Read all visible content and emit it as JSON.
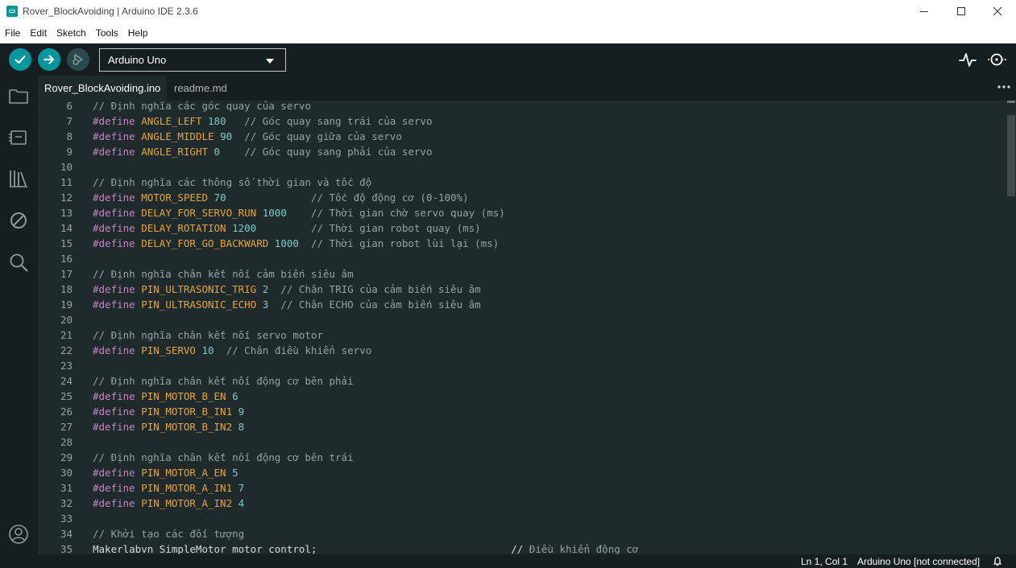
{
  "window": {
    "title": "Rover_BlockAvoiding | Arduino IDE 2.3.6"
  },
  "menu": [
    "File",
    "Edit",
    "Sketch",
    "Tools",
    "Help"
  ],
  "toolbar": {
    "verify_icon": "check-icon",
    "upload_icon": "arrow-right-icon",
    "debug_icon": "debug-icon",
    "board_selected": "Arduino Uno",
    "plotter_icon": "serial-plotter-icon",
    "monitor_icon": "serial-monitor-icon"
  },
  "sidebar": {
    "items": [
      "folder-icon",
      "board-manager-icon",
      "library-icon",
      "debug-disabled-icon",
      "search-icon"
    ],
    "bottom": "profile-icon"
  },
  "tabs": [
    {
      "label": "Rover_BlockAvoiding.ino",
      "active": true
    },
    {
      "label": "readme.md",
      "active": false
    }
  ],
  "editor": {
    "lines": [
      {
        "n": "6",
        "tokens": [
          [
            "cm",
            "// Định nghĩa các góc quay của servo"
          ]
        ]
      },
      {
        "n": "7",
        "tokens": [
          [
            "kw",
            "#define"
          ],
          [
            "plain",
            " "
          ],
          [
            "mac",
            "ANGLE_LEFT"
          ],
          [
            "plain",
            " "
          ],
          [
            "num",
            "180"
          ],
          [
            "plain",
            "   "
          ],
          [
            "cm",
            "// Góc quay sang trái của servo"
          ]
        ]
      },
      {
        "n": "8",
        "tokens": [
          [
            "kw",
            "#define"
          ],
          [
            "plain",
            " "
          ],
          [
            "mac",
            "ANGLE_MIDDLE"
          ],
          [
            "plain",
            " "
          ],
          [
            "num",
            "90"
          ],
          [
            "plain",
            "  "
          ],
          [
            "cm",
            "// Góc quay giữa của servo"
          ]
        ]
      },
      {
        "n": "9",
        "tokens": [
          [
            "kw",
            "#define"
          ],
          [
            "plain",
            " "
          ],
          [
            "mac",
            "ANGLE_RIGHT"
          ],
          [
            "plain",
            " "
          ],
          [
            "num",
            "0"
          ],
          [
            "plain",
            "    "
          ],
          [
            "cm",
            "// Góc quay sang phải của servo"
          ]
        ]
      },
      {
        "n": "10",
        "tokens": []
      },
      {
        "n": "11",
        "tokens": [
          [
            "cm",
            "// Định nghĩa các thông số thời gian và tốc độ"
          ]
        ]
      },
      {
        "n": "12",
        "tokens": [
          [
            "kw",
            "#define"
          ],
          [
            "plain",
            " "
          ],
          [
            "mac",
            "MOTOR_SPEED"
          ],
          [
            "plain",
            " "
          ],
          [
            "num",
            "70"
          ],
          [
            "plain",
            "              "
          ],
          [
            "cm",
            "// Tốc độ động cơ (0-100%)"
          ]
        ]
      },
      {
        "n": "13",
        "tokens": [
          [
            "kw",
            "#define"
          ],
          [
            "plain",
            " "
          ],
          [
            "mac",
            "DELAY_FOR_SERVO_RUN"
          ],
          [
            "plain",
            " "
          ],
          [
            "num",
            "1000"
          ],
          [
            "plain",
            "    "
          ],
          [
            "cm",
            "// Thời gian chờ servo quay (ms)"
          ]
        ]
      },
      {
        "n": "14",
        "tokens": [
          [
            "kw",
            "#define"
          ],
          [
            "plain",
            " "
          ],
          [
            "mac",
            "DELAY_ROTATION"
          ],
          [
            "plain",
            " "
          ],
          [
            "num",
            "1200"
          ],
          [
            "plain",
            "         "
          ],
          [
            "cm",
            "// Thời gian robot quay (ms)"
          ]
        ]
      },
      {
        "n": "15",
        "tokens": [
          [
            "kw",
            "#define"
          ],
          [
            "plain",
            " "
          ],
          [
            "mac",
            "DELAY_FOR_GO_BACKWARD"
          ],
          [
            "plain",
            " "
          ],
          [
            "num",
            "1000"
          ],
          [
            "plain",
            "  "
          ],
          [
            "cm",
            "// Thời gian robot lùi lại (ms)"
          ]
        ]
      },
      {
        "n": "16",
        "tokens": []
      },
      {
        "n": "17",
        "tokens": [
          [
            "cm",
            "// Định nghĩa chân kết nối cảm biến siêu âm"
          ]
        ]
      },
      {
        "n": "18",
        "tokens": [
          [
            "kw",
            "#define"
          ],
          [
            "plain",
            " "
          ],
          [
            "mac",
            "PIN_ULTRASONIC_TRIG"
          ],
          [
            "plain",
            " "
          ],
          [
            "num",
            "2"
          ],
          [
            "plain",
            "  "
          ],
          [
            "cm",
            "// Chân TRIG của cảm biến siêu âm"
          ]
        ]
      },
      {
        "n": "19",
        "tokens": [
          [
            "kw",
            "#define"
          ],
          [
            "plain",
            " "
          ],
          [
            "mac",
            "PIN_ULTRASONIC_ECHO"
          ],
          [
            "plain",
            " "
          ],
          [
            "num",
            "3"
          ],
          [
            "plain",
            "  "
          ],
          [
            "cm",
            "// Chân ECHO của cảm biến siêu âm"
          ]
        ]
      },
      {
        "n": "20",
        "tokens": []
      },
      {
        "n": "21",
        "tokens": [
          [
            "cm",
            "// Định nghĩa chân kết nối servo motor"
          ]
        ]
      },
      {
        "n": "22",
        "tokens": [
          [
            "kw",
            "#define"
          ],
          [
            "plain",
            " "
          ],
          [
            "mac",
            "PIN_SERVO"
          ],
          [
            "plain",
            " "
          ],
          [
            "num",
            "10"
          ],
          [
            "plain",
            "  "
          ],
          [
            "cm",
            "// Chân điều khiển servo"
          ]
        ]
      },
      {
        "n": "23",
        "tokens": []
      },
      {
        "n": "24",
        "tokens": [
          [
            "cm",
            "// Định nghĩa chân kết nối động cơ bên phải"
          ]
        ]
      },
      {
        "n": "25",
        "tokens": [
          [
            "kw",
            "#define"
          ],
          [
            "plain",
            " "
          ],
          [
            "mac",
            "PIN_MOTOR_B_EN"
          ],
          [
            "plain",
            " "
          ],
          [
            "num",
            "6"
          ]
        ]
      },
      {
        "n": "26",
        "tokens": [
          [
            "kw",
            "#define"
          ],
          [
            "plain",
            " "
          ],
          [
            "mac",
            "PIN_MOTOR_B_IN1"
          ],
          [
            "plain",
            " "
          ],
          [
            "num",
            "9"
          ]
        ]
      },
      {
        "n": "27",
        "tokens": [
          [
            "kw",
            "#define"
          ],
          [
            "plain",
            " "
          ],
          [
            "mac",
            "PIN_MOTOR_B_IN2"
          ],
          [
            "plain",
            " "
          ],
          [
            "num",
            "8"
          ]
        ]
      },
      {
        "n": "28",
        "tokens": []
      },
      {
        "n": "29",
        "tokens": [
          [
            "cm",
            "// Định nghĩa chân kết nối động cơ bên trái"
          ]
        ]
      },
      {
        "n": "30",
        "tokens": [
          [
            "kw",
            "#define"
          ],
          [
            "plain",
            " "
          ],
          [
            "mac",
            "PIN_MOTOR_A_EN"
          ],
          [
            "plain",
            " "
          ],
          [
            "num",
            "5"
          ]
        ]
      },
      {
        "n": "31",
        "tokens": [
          [
            "kw",
            "#define"
          ],
          [
            "plain",
            " "
          ],
          [
            "mac",
            "PIN_MOTOR_A_IN1"
          ],
          [
            "plain",
            " "
          ],
          [
            "num",
            "7"
          ]
        ]
      },
      {
        "n": "32",
        "tokens": [
          [
            "kw",
            "#define"
          ],
          [
            "plain",
            " "
          ],
          [
            "mac",
            "PIN_MOTOR_A_IN2"
          ],
          [
            "plain",
            " "
          ],
          [
            "num",
            "4"
          ]
        ]
      },
      {
        "n": "33",
        "tokens": []
      },
      {
        "n": "34",
        "tokens": [
          [
            "cm",
            "// Khởi tạo các đối tượng"
          ]
        ]
      },
      {
        "n": "35",
        "tokens": [
          [
            "plain",
            "Makerlabvn_SimpleMotor motor_control;                                // "
          ],
          [
            "cm",
            "Điều khiển động cơ"
          ]
        ]
      }
    ]
  },
  "status": {
    "position": "Ln 1, Col 1",
    "board": "Arduino Uno [not connected]",
    "bell_icon": "bell-icon"
  },
  "colors": {
    "accent": "#00979d",
    "editor_bg": "#1f2a2d",
    "chrome_bg": "#171e21",
    "keyword": "#c586c0",
    "macro": "#e5a539",
    "number": "#7fcac3",
    "comment": "#95a3a5"
  }
}
